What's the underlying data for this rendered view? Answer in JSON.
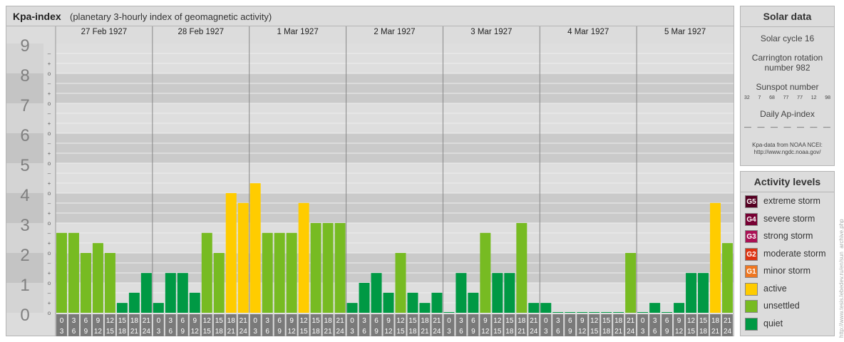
{
  "chart_data": {
    "type": "bar",
    "title": "Kpa-index",
    "subtitle": "(planetary 3-hourly index of geomagnetic activity)",
    "ylim": [
      0,
      9
    ],
    "y_ticks": [
      "0",
      "1",
      "2",
      "3",
      "4",
      "5",
      "6",
      "7",
      "8",
      "9"
    ],
    "minor_ticks": [
      "o",
      "+",
      "–"
    ],
    "days": [
      "27 Feb 1927",
      "28 Feb 1927",
      "1 Mar 1927",
      "2 Mar 1927",
      "3 Mar 1927",
      "4 Mar 1927",
      "5 Mar 1927"
    ],
    "hour_labels": [
      [
        "0",
        "3"
      ],
      [
        "3",
        "6"
      ],
      [
        "6",
        "9"
      ],
      [
        "9",
        "12"
      ],
      [
        "12",
        "15"
      ],
      [
        "15",
        "18"
      ],
      [
        "18",
        "21"
      ],
      [
        "21",
        "24"
      ]
    ],
    "values": [
      [
        2.67,
        2.67,
        2.0,
        2.33,
        2.0,
        0.33,
        0.67,
        1.33
      ],
      [
        0.33,
        1.33,
        1.33,
        0.67,
        2.67,
        2.0,
        4.0,
        3.67
      ],
      [
        4.33,
        2.67,
        2.67,
        2.67,
        3.67,
        3.0,
        3.0,
        3.0
      ],
      [
        0.33,
        1.0,
        1.33,
        0.67,
        2.0,
        0.67,
        0.33,
        0.67
      ],
      [
        0,
        1.33,
        0.67,
        2.67,
        1.33,
        1.33,
        3.0,
        0.33
      ],
      [
        0.33,
        0,
        0,
        0,
        0,
        0,
        0,
        2.0
      ],
      [
        0,
        0.33,
        0,
        0.33,
        1.33,
        1.33,
        3.67,
        2.33
      ]
    ],
    "level_colors": {
      "quiet": "#009944",
      "unsettled": "#77bb22",
      "active": "#ffcc00"
    }
  },
  "solar": {
    "title": "Solar data",
    "cycle": "Solar cycle 16",
    "carrington_1": "Carrington rotation",
    "carrington_2": "number 982",
    "sunspot_title": "Sunspot number",
    "sunspots": [
      "32",
      "7",
      "68",
      "77",
      "77",
      "12",
      "98"
    ],
    "ap_title": "Daily Ap-index",
    "ap": [
      "––",
      "––",
      "––",
      "––",
      "––",
      "––",
      "––"
    ],
    "source_1": "Kpa-data from NOAA NCEI:",
    "source_2": "http://www.ngdc.noaa.gov/"
  },
  "legend": {
    "title": "Activity levels",
    "items": [
      {
        "code": "G5",
        "label": "extreme storm",
        "color": "#550022"
      },
      {
        "code": "G4",
        "label": "severe storm",
        "color": "#770033"
      },
      {
        "code": "G3",
        "label": "strong storm",
        "color": "#aa1155"
      },
      {
        "code": "G2",
        "label": "moderate storm",
        "color": "#dd3311"
      },
      {
        "code": "G1",
        "label": "minor storm",
        "color": "#ee7722"
      },
      {
        "code": "",
        "label": "active",
        "color": "#ffcc00"
      },
      {
        "code": "",
        "label": "unsettled",
        "color": "#77bb22"
      },
      {
        "code": "",
        "label": "quiet",
        "color": "#009944"
      }
    ]
  },
  "watermark": "http://www.tesis.lebedev.ru/en/sun_archive.php"
}
